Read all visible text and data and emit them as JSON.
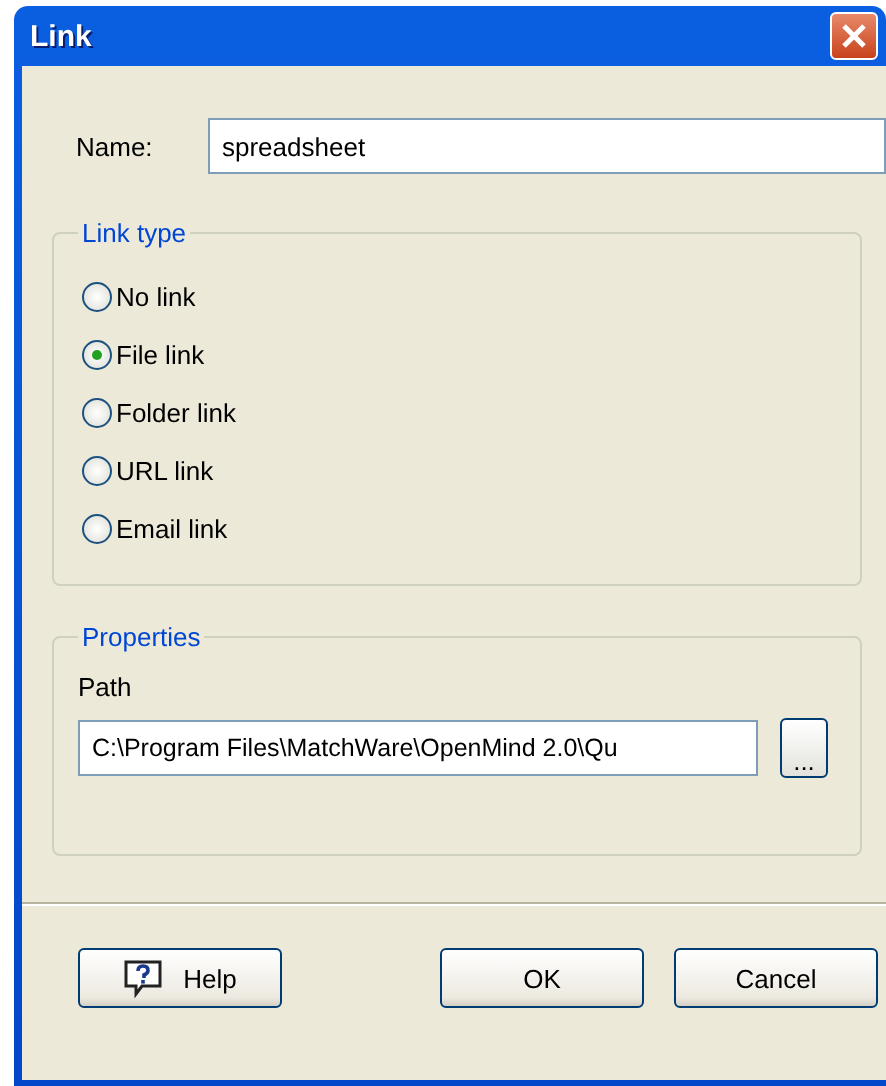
{
  "window": {
    "title": "Link"
  },
  "name_field": {
    "label": "Name:",
    "value": "spreadsheet"
  },
  "link_type": {
    "title": "Link type",
    "options": [
      {
        "label": "No link",
        "selected": false
      },
      {
        "label": "File link",
        "selected": true
      },
      {
        "label": "Folder link",
        "selected": false
      },
      {
        "label": "URL link",
        "selected": false
      },
      {
        "label": "Email link",
        "selected": false
      }
    ]
  },
  "properties": {
    "title": "Properties",
    "path_label": "Path",
    "path_value": "C:\\Program Files\\MatchWare\\OpenMind 2.0\\Qu",
    "browse": "..."
  },
  "buttons": {
    "help": "Help",
    "ok": "OK",
    "cancel": "Cancel"
  }
}
